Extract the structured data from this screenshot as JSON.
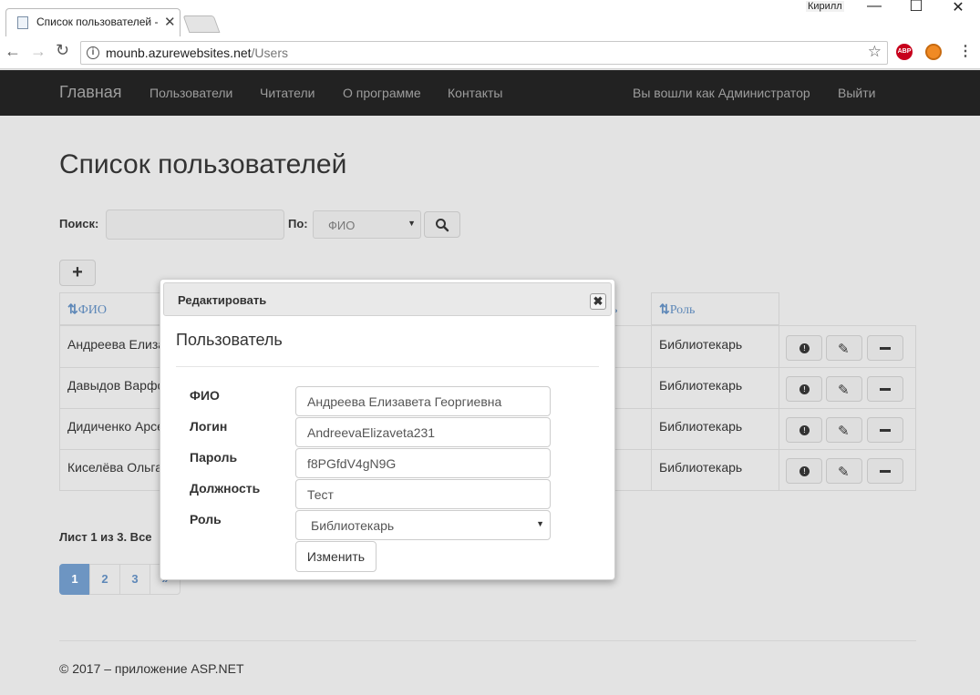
{
  "browser": {
    "tab_title": "Список пользователей -",
    "user_name": "Кирилл",
    "url_host": "mounb.azurewebsites.net",
    "url_path": "/Users",
    "ext_abp": "ABP"
  },
  "navbar": {
    "brand": "Главная",
    "links": [
      "Пользователи",
      "Читатели",
      "О программе",
      "Контакты"
    ],
    "logged_in": "Вы вошли как Администратор",
    "logout": "Выйти"
  },
  "page": {
    "title": "Список пользователей",
    "search_label": "Поиск:",
    "search_value": "",
    "by_label": "По:",
    "by_value": "ФИО",
    "add_symbol": "+"
  },
  "table": {
    "columns": [
      "ФИО",
      "Роль"
    ],
    "sort_icon": "⇅",
    "rows": [
      {
        "fio": "Андреева Елиза",
        "role": "Библиотекарь"
      },
      {
        "fio": "Давыдов Варфо",
        "role": "Библиотекарь"
      },
      {
        "fio": "Дидиченко Арсе",
        "role": "Библиотекарь"
      },
      {
        "fio": "Киселёва Ольга",
        "role": "Библиотекарь"
      }
    ],
    "col3_fragment": "ь"
  },
  "pager": {
    "summary": "Лист 1 из 3. Все",
    "pages": [
      "1",
      "2",
      "3"
    ],
    "next": "»"
  },
  "footer": "© 2017 – приложение ASP.NET",
  "dialog": {
    "title": "Редактировать",
    "close": "✖",
    "heading": "Пользователь",
    "fields": [
      {
        "label": "ФИО",
        "value": "Андреева Елизавета Георгиевна"
      },
      {
        "label": "Логин",
        "value": "AndreevaElizaveta231"
      },
      {
        "label": "Пароль",
        "value": "f8PGfdV4gN9G"
      },
      {
        "label": "Должность",
        "value": "Тест"
      },
      {
        "label": "Роль",
        "value": "Библиотекарь"
      }
    ],
    "submit": "Изменить"
  }
}
